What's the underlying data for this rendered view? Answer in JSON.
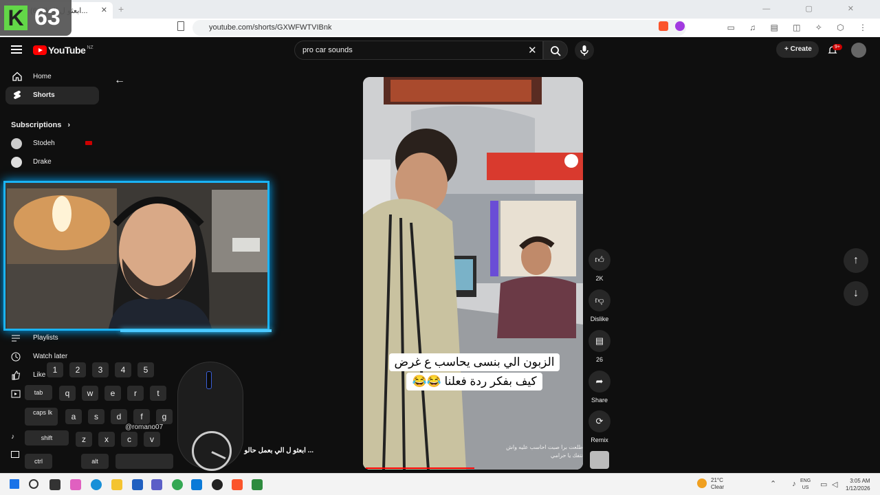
{
  "browser": {
    "tab_title": "(665) ابعثو ل ال... ",
    "new_tab": "+",
    "url": "youtube.com/shorts/GXWFWTVIBnk",
    "window_controls": "— ▢ ✕",
    "toolbar_icons": "▭ ♫ ▤ ◫ ✧ ⬡ ⋮"
  },
  "overlay_badge": {
    "letter": "K",
    "number": "63"
  },
  "youtube": {
    "logo_text": "YouTube",
    "country": "NZ",
    "search_value": "pro car sounds",
    "search_clear": "✕",
    "create_label": "Create",
    "create_plus": "+",
    "notif_badge": "9+"
  },
  "sidebar": {
    "home": "Home",
    "shorts": "Shorts",
    "subscriptions": "Subscriptions",
    "subs_chevron": "›",
    "channels": [
      {
        "name": "Stodeh"
      },
      {
        "name": "Drake"
      }
    ],
    "playlists": "Playlists",
    "watch_later": "Watch later",
    "liked": "Like",
    "explore": "Exp"
  },
  "short": {
    "caption_line1": "الزبون الي بنسى يحاسب ع غرض",
    "caption_line2": "كيف بفكر ردة فعلنا 😂😂",
    "channel_text": "طلعت برا صبت احاسب عليه واش نتفك يا حرامي",
    "like_count": "2K",
    "dislike": "Dislike",
    "comments": "26",
    "share": "Share",
    "remix": "Remix",
    "progress_fraction": 0.5
  },
  "overlays": {
    "username_partial": "@romano07",
    "title_partial": "... ابعثو ل الي بعمل حالو"
  },
  "keyboard": {
    "row1": [
      "1",
      "2",
      "3",
      "4",
      "5"
    ],
    "row2": [
      "tab",
      "q",
      "w",
      "e",
      "r",
      "t"
    ],
    "row3": [
      "caps lk",
      "a",
      "s",
      "d",
      "f",
      "g"
    ],
    "row4": [
      "shift",
      "z",
      "x",
      "c",
      "v"
    ],
    "row5": [
      "ctrl",
      "alt"
    ]
  },
  "taskbar": {
    "temperature": "21°C",
    "condition": "Clear",
    "lang_line1": "ENG",
    "lang_line2": "US",
    "time": "3:05 AM",
    "date": "1/12/2026"
  },
  "colors": {
    "accent_red": "#ff0000",
    "webcam_border": "#1ab3f5",
    "brand_green": "#58d53b"
  }
}
